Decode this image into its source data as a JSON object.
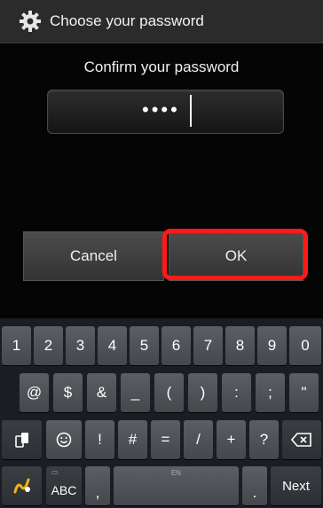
{
  "dialog": {
    "title": "Choose your password",
    "prompt": "Confirm your password",
    "password_masked": "••••",
    "cancel_label": "Cancel",
    "ok_label": "OK"
  },
  "keyboard": {
    "row1": [
      "1",
      "2",
      "3",
      "4",
      "5",
      "6",
      "7",
      "8",
      "9",
      "0"
    ],
    "row2": [
      "@",
      "$",
      "&",
      "_",
      "(",
      ")",
      ":",
      ";",
      "\""
    ],
    "row3": [
      "!",
      "#",
      "=",
      "/",
      "+",
      "?"
    ],
    "abc_label": "ABC",
    "comma": ",",
    "period": ".",
    "space_hint": "EN",
    "next_label": "Next"
  },
  "colors": {
    "highlight": "#ff1a1a",
    "background": "#050505"
  }
}
